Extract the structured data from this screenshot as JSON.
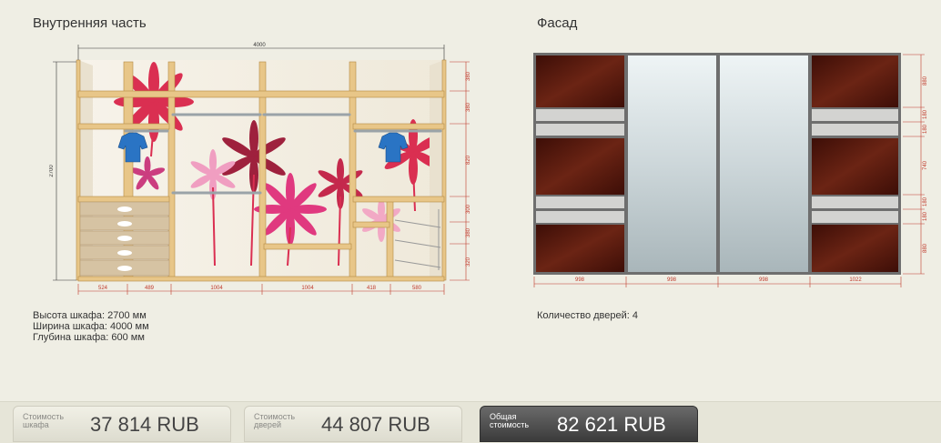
{
  "interior": {
    "title": "Внутренняя часть",
    "width_label": "4000",
    "height_label": "2700",
    "right_dims": [
      "380",
      "380",
      "820",
      "300",
      "380",
      "320"
    ],
    "bottom_dims": [
      "524",
      "489",
      "1004",
      "1004",
      "418",
      "580"
    ]
  },
  "facade": {
    "title": "Фасад",
    "bottom_dims": [
      "998",
      "998",
      "998",
      "1022"
    ],
    "right_dims": [
      "880",
      "180",
      "180",
      "740",
      "180",
      "180",
      "880"
    ]
  },
  "specs": {
    "height": "Высота шкафа: 2700 мм",
    "width": "Ширина шкафа: 4000 мм",
    "depth": "Глубина шкафа: 600 мм",
    "doors": "Количество дверей: 4"
  },
  "prices": {
    "cabinet": {
      "label": "Стоимость шкафа",
      "value": "37 814  RUB"
    },
    "doors": {
      "label": "Стоимость дверей",
      "value": "44 807  RUB"
    },
    "total": {
      "label": "Общая стоимость",
      "value": "82 621  RUB"
    }
  },
  "colors": {
    "wood": "#e8c688",
    "veneer": "#5b1a10",
    "mirror": "#c9d6d9",
    "frame": "#6e6e6e",
    "dimension": "#c0392b"
  }
}
